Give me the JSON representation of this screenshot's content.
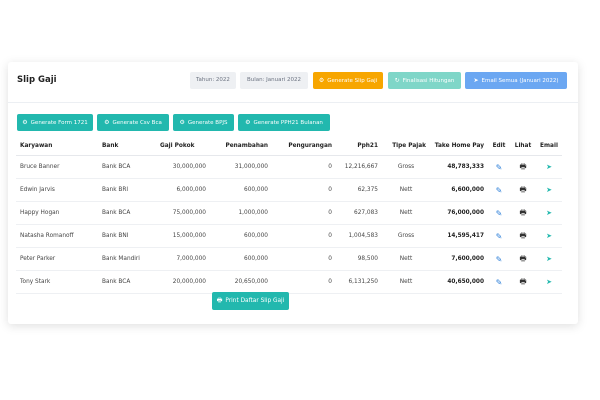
{
  "header": {
    "title": "Slip Gaji",
    "year_filter": "Tahun: 2022",
    "month_filter": "Bulan: Januari 2022",
    "generate_slip": "Generate Slip Gaji",
    "finalisasi": "Finalisasi Hitungan",
    "email_all": "Email Semua (Januari 2022)"
  },
  "actions": {
    "form1721": "Generate Form 1721",
    "csv_bca": "Generate Csv Bca",
    "bpjs": "Generate BPJS",
    "pph21": "Generate PPH21 Bulanan"
  },
  "table": {
    "headers": [
      "Karyawan",
      "Bank",
      "Gaji Pokok",
      "Penambahan",
      "Pengurangan",
      "Pph21",
      "Tipe Pajak",
      "Take Home Pay",
      "Edit",
      "Lihat",
      "Email"
    ],
    "rows": [
      [
        "Bruce Banner",
        "Bank BCA",
        "30,000,000",
        "31,000,000",
        "0",
        "12,216,667",
        "Gross",
        "48,783,333"
      ],
      [
        "Edwin Jarvis",
        "Bank BRI",
        "6,000,000",
        "600,000",
        "0",
        "62,375",
        "Nett",
        "6,600,000"
      ],
      [
        "Happy Hogan",
        "Bank BCA",
        "75,000,000",
        "1,000,000",
        "0",
        "627,083",
        "Nett",
        "76,000,000"
      ],
      [
        "Natasha Romanoff",
        "Bank BNI",
        "15,000,000",
        "600,000",
        "0",
        "1,004,583",
        "Gross",
        "14,595,417"
      ],
      [
        "Peter Parker",
        "Bank Mandiri",
        "7,000,000",
        "600,000",
        "0",
        "98,500",
        "Nett",
        "7,600,000"
      ],
      [
        "Tony Stark",
        "Bank BCA",
        "20,000,000",
        "20,650,000",
        "0",
        "6,131,250",
        "Nett",
        "40,650,000"
      ]
    ]
  },
  "footer": {
    "print": "Print Daftar Slip Gaji"
  },
  "icons": {
    "gear": "gear-icon",
    "refresh": "refresh-icon",
    "send": "send-icon",
    "edit": "edit-icon",
    "print": "print-icon"
  },
  "colors": {
    "teal": "#22b8ae",
    "orange": "#f7a600",
    "blue": "#6ba7f2"
  }
}
